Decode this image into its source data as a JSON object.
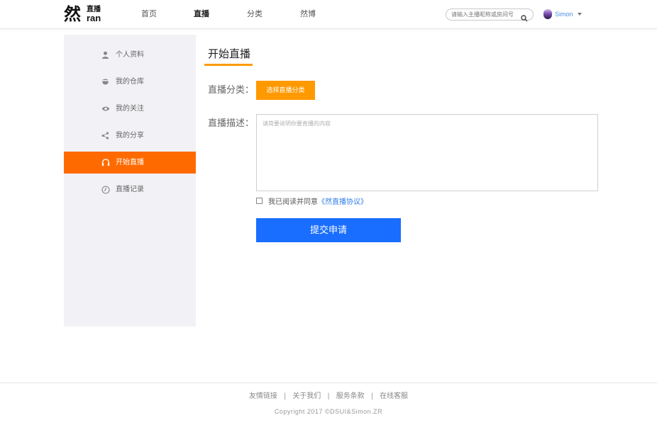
{
  "header": {
    "logo": {
      "big": "然",
      "small_top": "直播",
      "small_bottom": "ran"
    },
    "nav": [
      {
        "label": "首页",
        "active": false
      },
      {
        "label": "直播",
        "active": true
      },
      {
        "label": "分类",
        "active": false
      },
      {
        "label": "然博",
        "active": false
      }
    ],
    "search": {
      "placeholder": "请输入主播昵称或房间号",
      "icon": "search-icon"
    },
    "user": {
      "name": "Simon",
      "icon": "chevron-down-icon"
    }
  },
  "sidebar": {
    "items": [
      {
        "label": "个人资料",
        "icon": "user-icon",
        "active": false
      },
      {
        "label": "我的仓库",
        "icon": "warehouse-icon",
        "active": false
      },
      {
        "label": "我的关注",
        "icon": "eye-icon",
        "active": false
      },
      {
        "label": "我的分享",
        "icon": "share-icon",
        "active": false
      },
      {
        "label": "开始直播",
        "icon": "headphones-icon",
        "active": true
      },
      {
        "label": "直播记录",
        "icon": "clock-icon",
        "active": false
      }
    ]
  },
  "main": {
    "title": "开始直播",
    "category_label": "直播分类：",
    "category_button": "选择直播分类",
    "description_label": "直播描述：",
    "description_placeholder": "请简要说明你要直播的内容",
    "agree_text": "我已阅读并同意",
    "agree_link": "《然直播协议》",
    "submit_label": "提交申请"
  },
  "footer": {
    "links": [
      "友情链接",
      "关于我们",
      "服务条款",
      "在线客服"
    ],
    "separator": "|",
    "copyright": "Copyright 2017 ©DSUI&Simon.ZR"
  },
  "colors": {
    "accent_orange": "#ff6a00",
    "button_orange": "#ff9900",
    "submit_blue": "#1a6eff",
    "link_blue": "#2f7be6",
    "sidebar_bg": "#f2f2f6"
  }
}
